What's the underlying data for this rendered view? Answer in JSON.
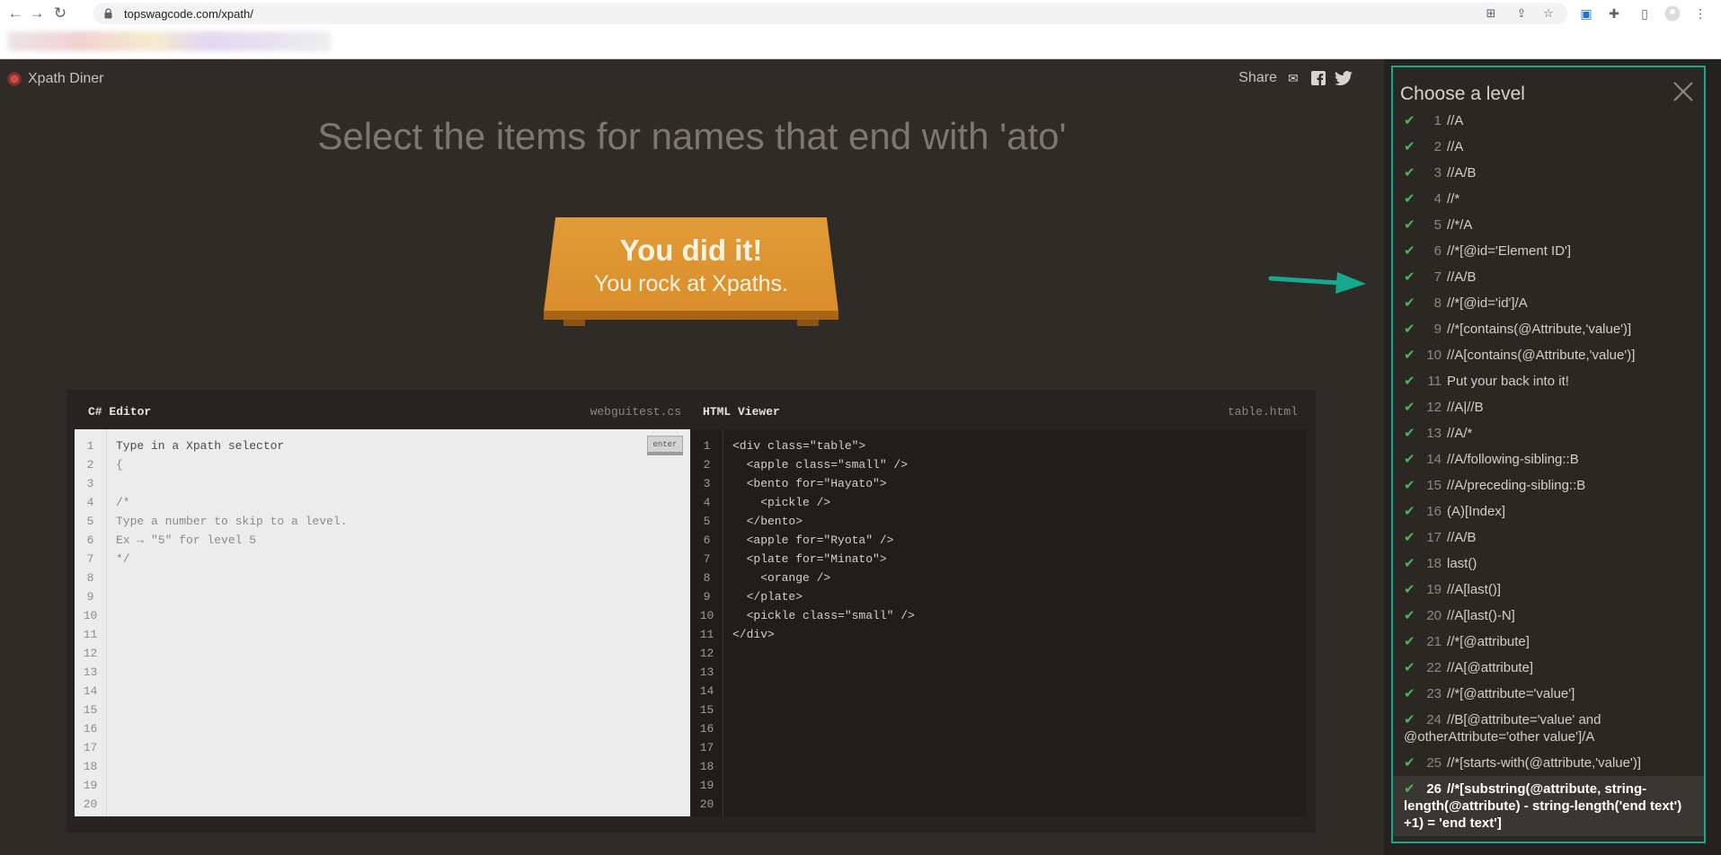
{
  "browser": {
    "url": "topswagcode.com/xpath/",
    "icons": [
      "back-icon",
      "forward-icon",
      "reload-icon",
      "lock-icon",
      "translate-icon",
      "share-icon",
      "bookmark-star-icon",
      "zoom-icon",
      "extensions-icon",
      "sidepanel-icon",
      "profile-icon",
      "menu-icon"
    ]
  },
  "game": {
    "logo": "Xpath Diner",
    "share_label": "Share",
    "instruction": "Select the items for names that end with 'ato'",
    "success_line1": "You did it!",
    "success_line2": "You rock at Xpaths.",
    "editor": {
      "title": "C# Editor",
      "file": "webguitest.cs",
      "enter_label": "enter",
      "lines": [
        "1",
        "2",
        "3",
        "4",
        "5",
        "6",
        "7",
        "8",
        "9",
        "10",
        "11",
        "12",
        "13",
        "14",
        "15",
        "16",
        "17",
        "18",
        "19",
        "20"
      ],
      "code": [
        "Type in a Xpath selector",
        "{",
        "",
        "/*",
        "Type a number to skip to a level.",
        "Ex → \"5\" for level 5",
        "*/"
      ]
    },
    "viewer": {
      "title": "HTML Viewer",
      "file": "table.html",
      "lines": [
        "1",
        "2",
        "3",
        "4",
        "5",
        "6",
        "7",
        "8",
        "9",
        "10",
        "11",
        "12",
        "13",
        "14",
        "15",
        "16",
        "17",
        "18",
        "19",
        "20"
      ],
      "code": [
        "<div class=\"table\">",
        "  <apple class=\"small\" />",
        "  <bento for=\"Hayato\">",
        "    <pickle />",
        "  </bento>",
        "  <apple for=\"Ryota\" />",
        "  <plate for=\"Minato\">",
        "    <orange />",
        "  </plate>",
        "  <pickle class=\"small\" />",
        "</div>"
      ]
    }
  },
  "levels_panel": {
    "title": "Choose a level",
    "accent": "#17a98e",
    "levels": [
      {
        "num": "1",
        "sel": "//A"
      },
      {
        "num": "2",
        "sel": "//A"
      },
      {
        "num": "3",
        "sel": "//A/B"
      },
      {
        "num": "4",
        "sel": "//*"
      },
      {
        "num": "5",
        "sel": "//*/A"
      },
      {
        "num": "6",
        "sel": "//*[@id='Element ID']"
      },
      {
        "num": "7",
        "sel": "//A/B"
      },
      {
        "num": "8",
        "sel": "//*[@id='id']/A"
      },
      {
        "num": "9",
        "sel": "//*[contains(@Attribute,'value')]"
      },
      {
        "num": "10",
        "sel": "//A[contains(@Attribute,'value')]"
      },
      {
        "num": "11",
        "sel": "Put your back into it!"
      },
      {
        "num": "12",
        "sel": "//A|//B"
      },
      {
        "num": "13",
        "sel": "//A/*"
      },
      {
        "num": "14",
        "sel": "//A/following-sibling::B"
      },
      {
        "num": "15",
        "sel": "//A/preceding-sibling::B"
      },
      {
        "num": "16",
        "sel": "(A)[Index]"
      },
      {
        "num": "17",
        "sel": "//A/B"
      },
      {
        "num": "18",
        "sel": "last()"
      },
      {
        "num": "19",
        "sel": "//A[last()]"
      },
      {
        "num": "20",
        "sel": "//A[last()-N]"
      },
      {
        "num": "21",
        "sel": "//*[@attribute]"
      },
      {
        "num": "22",
        "sel": "//A[@attribute]"
      },
      {
        "num": "23",
        "sel": "//*[@attribute='value']"
      },
      {
        "num": "24",
        "sel": "//B[@attribute='value' and @otherAttribute='other value']/A"
      },
      {
        "num": "25",
        "sel": "//*[starts-with(@attribute,'value')]"
      },
      {
        "num": "26",
        "sel": "//*[substring(@attribute, string-length(@attribute) - string-length('end text') +1) = 'end text']"
      }
    ]
  }
}
